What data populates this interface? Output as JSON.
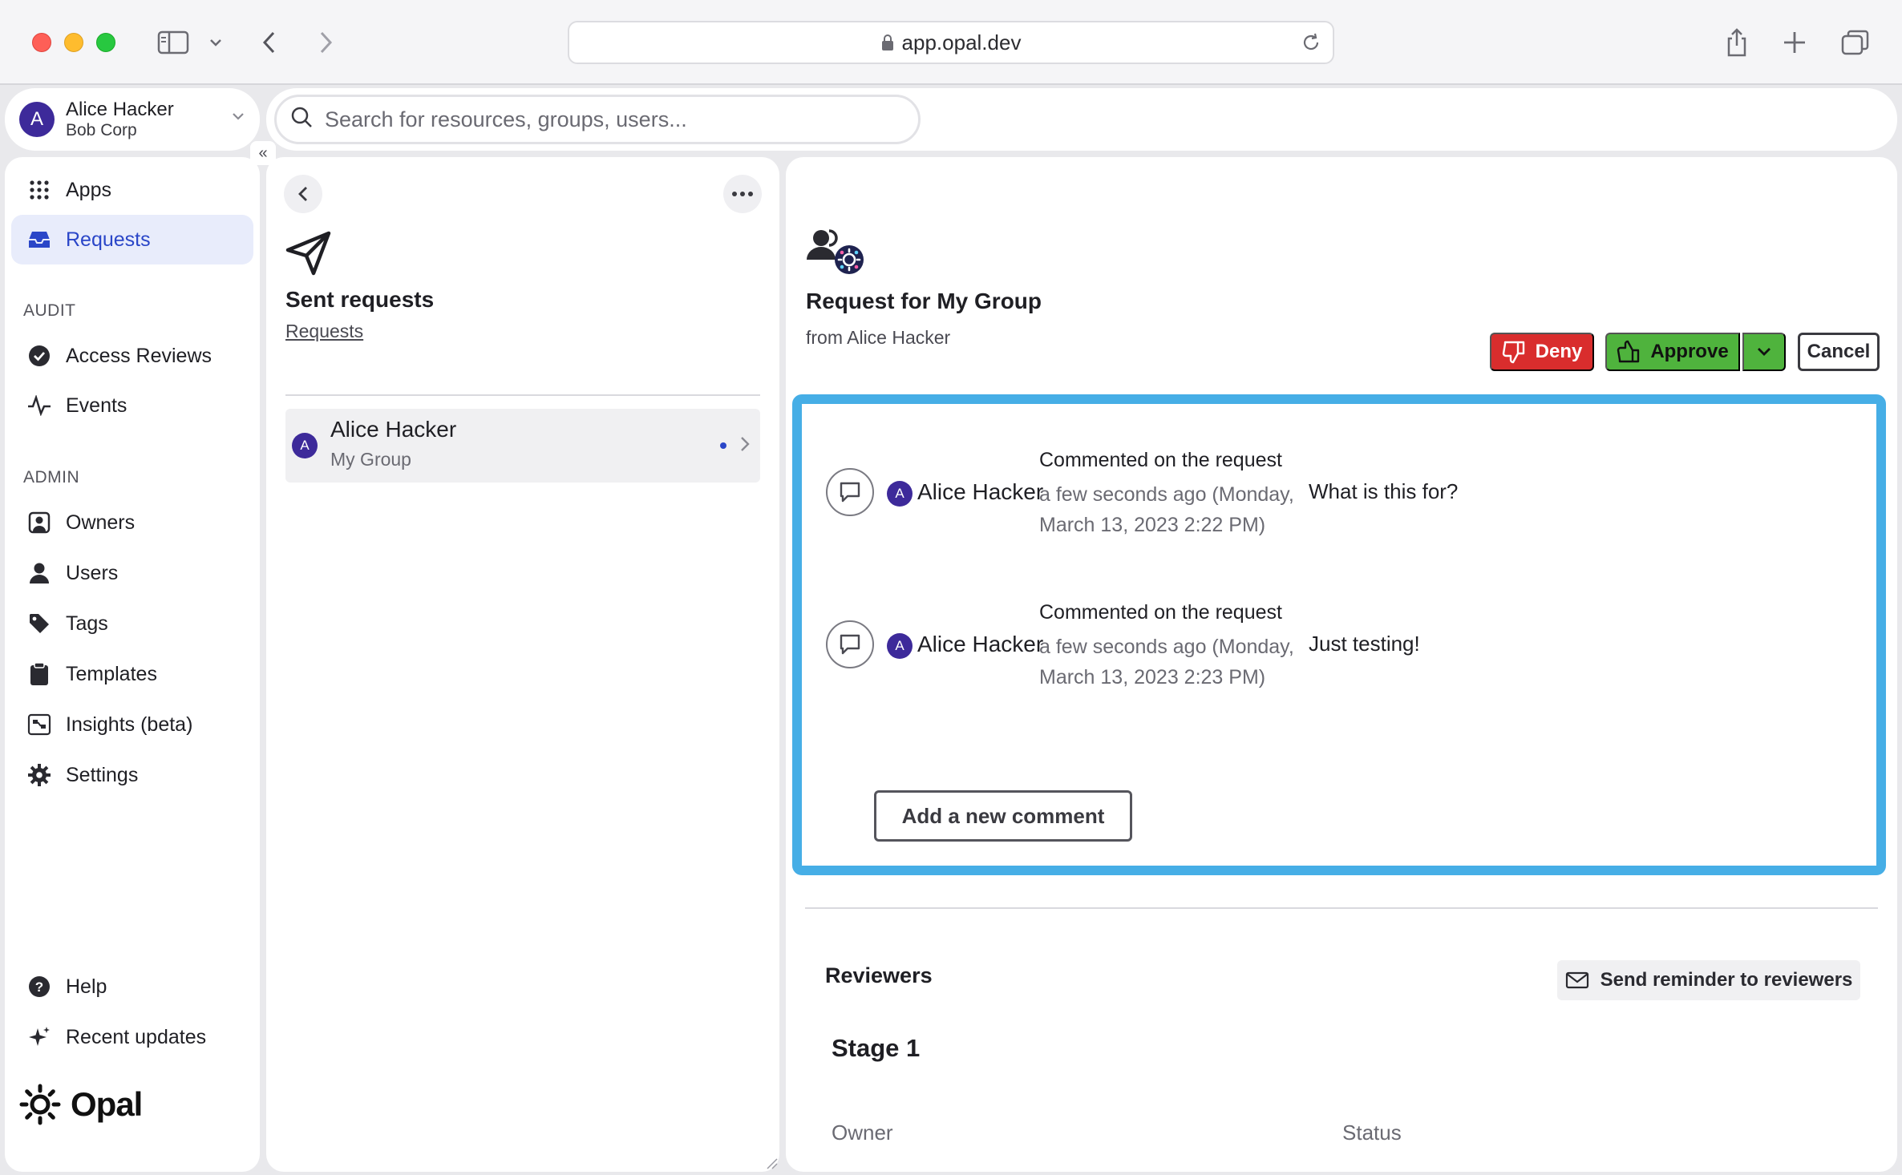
{
  "browser": {
    "url": "app.opal.dev"
  },
  "account": {
    "avatar_initial": "A",
    "name": "Alice Hacker",
    "org": "Bob Corp"
  },
  "search": {
    "placeholder": "Search for resources, groups, users..."
  },
  "sidebar": {
    "collapse_label": "«",
    "primary": [
      {
        "label": "Apps",
        "icon": "grid-icon"
      },
      {
        "label": "Requests",
        "icon": "inbox-icon",
        "active": true
      }
    ],
    "audit_label": "AUDIT",
    "audit": [
      {
        "label": "Access Reviews",
        "icon": "check-circle-icon"
      },
      {
        "label": "Events",
        "icon": "activity-icon"
      }
    ],
    "admin_label": "ADMIN",
    "admin": [
      {
        "label": "Owners",
        "icon": "owner-icon"
      },
      {
        "label": "Users",
        "icon": "user-icon"
      },
      {
        "label": "Tags",
        "icon": "tag-icon"
      },
      {
        "label": "Templates",
        "icon": "clipboard-icon"
      },
      {
        "label": "Insights (beta)",
        "icon": "insights-icon"
      },
      {
        "label": "Settings",
        "icon": "gear-icon"
      }
    ],
    "footer": [
      {
        "label": "Help",
        "icon": "help-icon"
      },
      {
        "label": "Recent updates",
        "icon": "sparkle-icon"
      }
    ],
    "brand": "Opal"
  },
  "list": {
    "title": "Sent requests",
    "breadcrumb": "Requests",
    "rows": [
      {
        "avatar_initial": "A",
        "name": "Alice Hacker",
        "target": "My Group"
      }
    ]
  },
  "detail": {
    "title": "Request for My Group",
    "from": "from Alice Hacker",
    "actions": {
      "deny": "Deny",
      "approve": "Approve",
      "cancel": "Cancel"
    },
    "comments": [
      {
        "avatar_initial": "A",
        "author": "Alice Hacker",
        "action": "Commented on the request",
        "when": "a few seconds ago (Monday, March 13, 2023 2:22 PM)",
        "text": "What is this for?"
      },
      {
        "avatar_initial": "A",
        "author": "Alice Hacker",
        "action": "Commented on the request",
        "when": "a few seconds ago (Monday, March 13, 2023 2:23 PM)",
        "text": "Just testing!"
      }
    ],
    "add_comment": "Add a new comment",
    "reviewers_title": "Reviewers",
    "reminder": "Send reminder to reviewers",
    "stage_title": "Stage 1",
    "columns": [
      "Owner",
      "Status"
    ]
  },
  "colors": {
    "accent": "#2a46c8",
    "deny": "#d92d2d",
    "approve": "#4fb33d",
    "highlight": "#46aee6",
    "avatar": "#3d2a9a"
  }
}
